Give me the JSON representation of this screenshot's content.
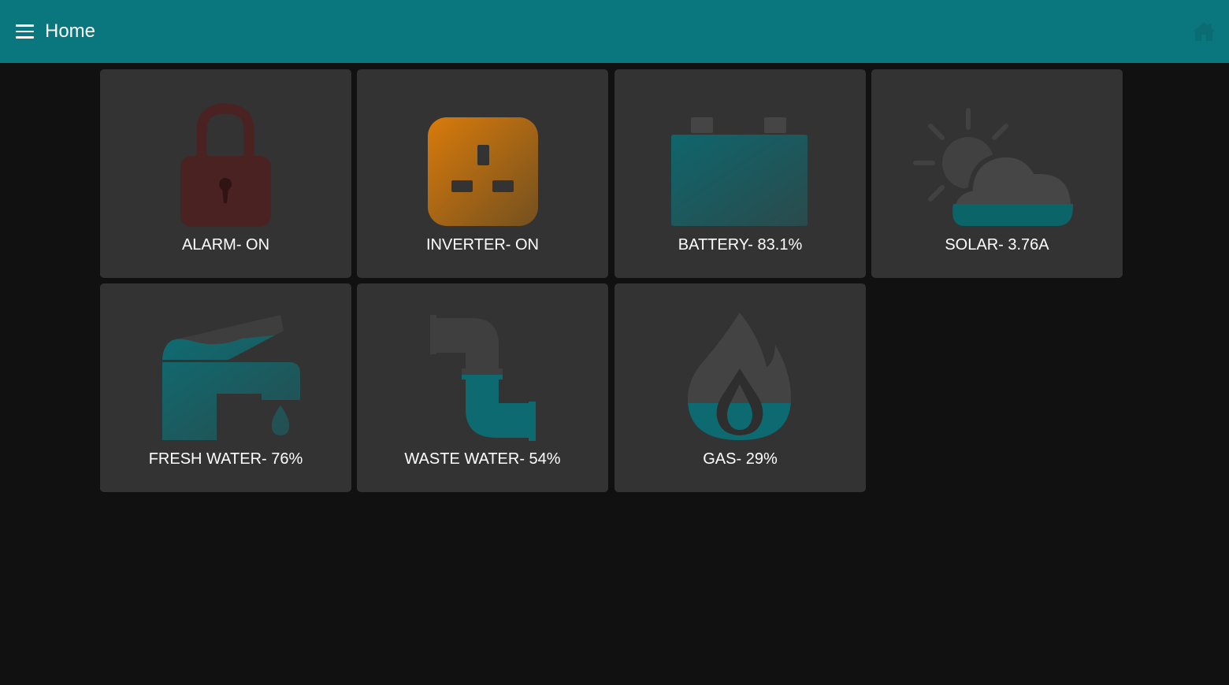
{
  "header": {
    "title": "Home",
    "menu_icon": "hamburger-menu-icon",
    "home_icon": "home-icon",
    "background_color": "#0a767d"
  },
  "tiles": [
    {
      "label": "ALARM- ON",
      "icon": "padlock-icon",
      "state": "on",
      "color": "#5a2424"
    },
    {
      "label": "INVERTER- ON",
      "icon": "power-socket-icon",
      "state": "on",
      "color": "#d4780d"
    },
    {
      "label": "BATTERY- 83.1%",
      "icon": "battery-icon",
      "level": 0.831,
      "color": "#0d6a70"
    },
    {
      "label": "SOLAR- 3.76A",
      "icon": "sun-cloud-icon",
      "color": "#0d6a70"
    },
    {
      "label": "FRESH WATER- 76%",
      "icon": "tap-icon",
      "level": 0.76,
      "color": "#0d6a70"
    },
    {
      "label": "WASTE WATER- 54%",
      "icon": "pipe-icon",
      "level": 0.54,
      "color": "#0d6a70"
    },
    {
      "label": "GAS- 29%",
      "icon": "flame-icon",
      "level": 0.29,
      "color": "#0d6a70"
    }
  ],
  "colors": {
    "background": "#111111",
    "tile": "#333333",
    "icon_empty": "#3e3e3e",
    "text": "#ffffff"
  }
}
